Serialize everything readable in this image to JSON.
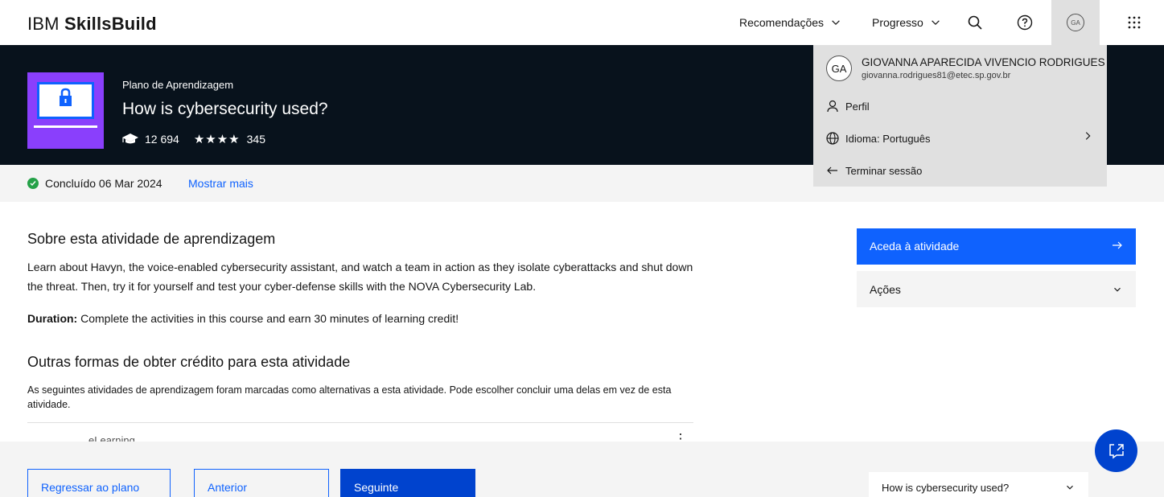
{
  "header": {
    "logo_prefix": "IBM",
    "logo_bold": "SkillsBuild",
    "nav": [
      {
        "label": "Recomendações"
      },
      {
        "label": "Progresso"
      }
    ],
    "avatar_initials": "GA"
  },
  "banner": {
    "eyebrow": "Plano de Aprendizagem",
    "title": "How is cybersecurity used?",
    "learners": "12 694",
    "stars": "★★★★",
    "ratings": "345"
  },
  "status": {
    "completed": "Concluído 06 Mar 2024",
    "more": "Mostrar mais"
  },
  "main": {
    "about_heading": "Sobre esta atividade de aprendizagem",
    "about_text": "Learn about Havyn, the voice-enabled cybersecurity assistant, and watch a team in action as they isolate cyberattacks and shut down the threat. Then, try it for yourself and test your cyber-defense skills with the NOVA Cybersecurity Lab.",
    "duration_label": "Duration:",
    "duration_text": " Complete the activities in this course and earn 30 minutes of learning credit!",
    "other_heading": "Outras formas de obter crédito para esta atividade",
    "other_text": "As seguintes atividades de aprendizagem foram marcadas como alternativas a esta atividade. Pode escolher concluir uma delas em vez de esta atividade.",
    "item_type": "eLearning"
  },
  "sidebar": {
    "cta": "Aceda à atividade",
    "actions": "Ações"
  },
  "profile": {
    "initials": "GA",
    "name": "GIOVANNA APARECIDA VIVENCIO RODRIGUES",
    "email": "giovanna.rodrigues81@etec.sp.gov.br",
    "profile_label": "Perfil",
    "language_label": "Idioma: Português",
    "logout_label": "Terminar sessão"
  },
  "footer": {
    "back": "Regressar ao plano",
    "prev": "Anterior",
    "next": "Seguinte",
    "select_value": "How is cybersecurity used?"
  },
  "colors": {
    "primary": "#0f62fe",
    "banner_bg": "#08121c",
    "thumb_bg": "#8a3ffc",
    "success": "#24a148"
  }
}
